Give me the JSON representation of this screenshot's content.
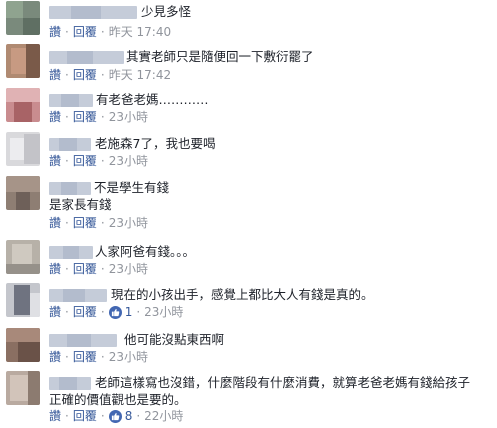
{
  "ui": {
    "like_label": "讚",
    "reply_label": "回覆",
    "separator": "·"
  },
  "comments": [
    {
      "text": "少見多怪",
      "time": "昨天 17:40"
    },
    {
      "text": "其實老師只是隨便回一下敷衍罷了",
      "time": "昨天 17:42"
    },
    {
      "text": "有老爸老媽…………",
      "time": "23小時"
    },
    {
      "text": "老施森7了，我也要喝",
      "time": "23小時"
    },
    {
      "text": "不是學生有錢",
      "text2": "是家長有錢",
      "time": "23小時"
    },
    {
      "text": "人家阿爸有錢。。。",
      "time": "23小時"
    },
    {
      "text": "現在的小孩出手，感覺上都比大人有錢是真的。",
      "likes": "1",
      "time": "23小時"
    },
    {
      "text": "他可能沒點東西啊",
      "time": "23小時"
    },
    {
      "text": "老師這樣寫也沒錯，什麼階段有什麼消費，就算老爸老媽有錢給孩子正確的價值觀也是要的。",
      "likes": "8",
      "time": "22小時"
    }
  ],
  "colors": {
    "link": "#365899",
    "meta": "#90949c",
    "text": "#1d2129",
    "like_badge": "#4267b2"
  }
}
